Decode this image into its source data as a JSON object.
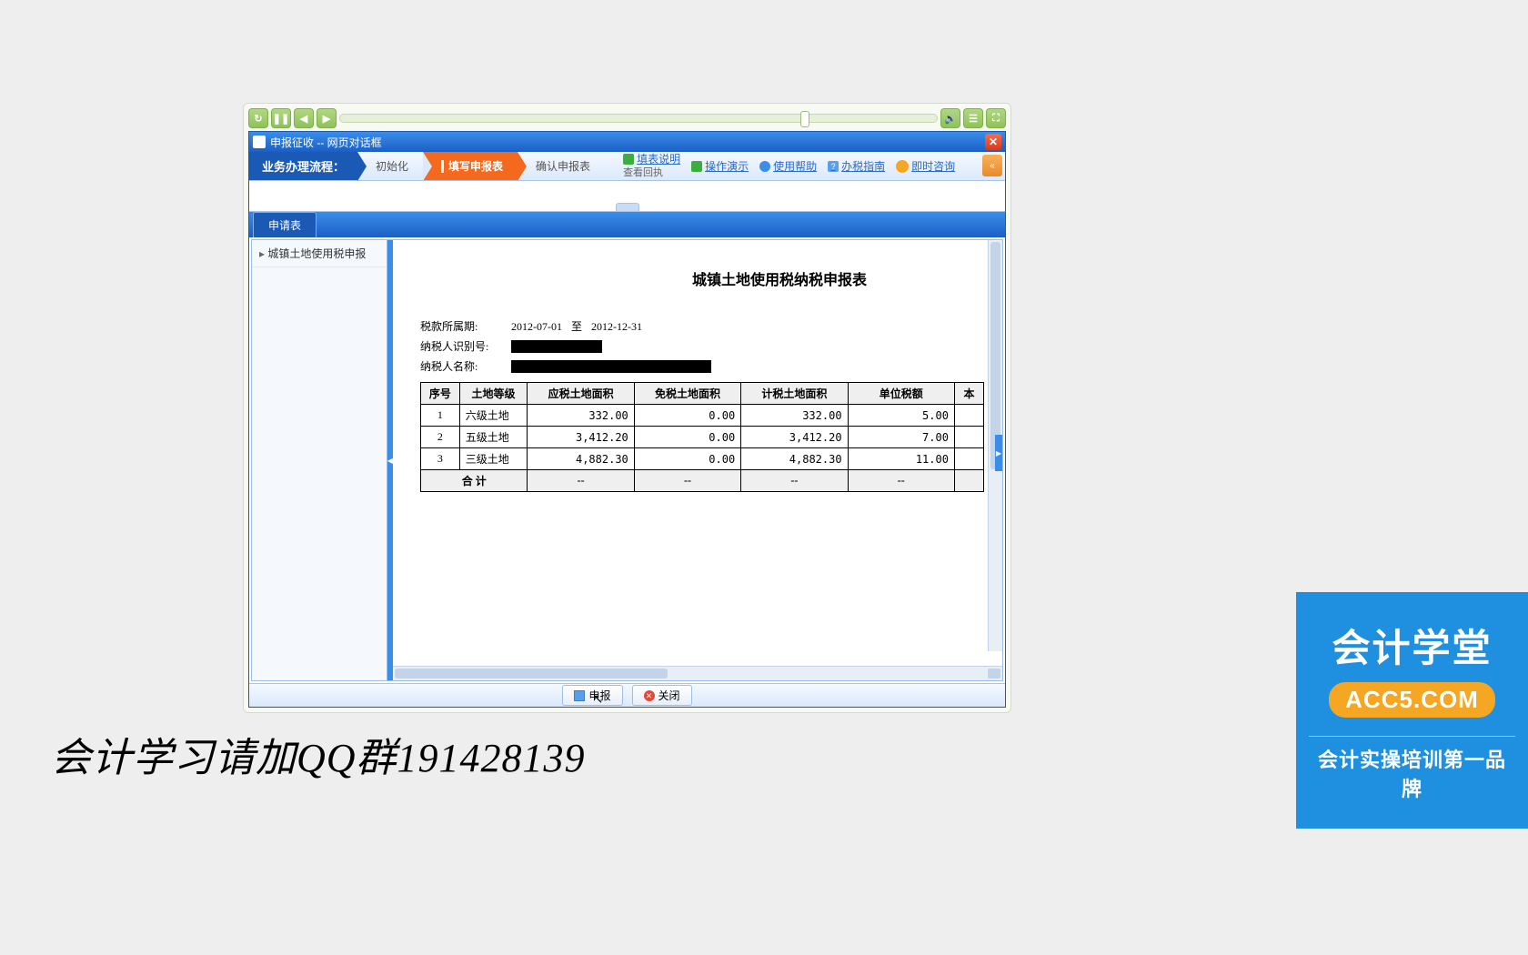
{
  "window": {
    "title": "申报征收  --  网页对话框"
  },
  "flow": {
    "label": "业务办理流程：",
    "steps": [
      "初始化",
      "填写申报表",
      "确认申报表"
    ],
    "active_index": 1,
    "sublink": "查看回执"
  },
  "toolbar_links": [
    "填表说明",
    "操作演示",
    "使用帮助",
    "办税指南",
    "即时咨询"
  ],
  "tab": "申请表",
  "sidebar": {
    "items": [
      "城镇土地使用税申报"
    ]
  },
  "report": {
    "title": "城镇土地使用税纳税申报表",
    "period_label": "税款所属期:",
    "period_from": "2012-07-01",
    "period_sep": "至",
    "period_to": "2012-12-31",
    "taxpayer_id_label": "纳税人识别号:",
    "taxpayer_name_label": "纳税人名称:",
    "columns": [
      "序号",
      "土地等级",
      "应税土地面积",
      "免税土地面积",
      "计税土地面积",
      "单位税额",
      "本"
    ],
    "rows": [
      {
        "no": "1",
        "grade": "六级土地",
        "taxable_area": "332.00",
        "exempt_area": "0.00",
        "calc_area": "332.00",
        "unit_tax": "5.00"
      },
      {
        "no": "2",
        "grade": "五级土地",
        "taxable_area": "3,412.20",
        "exempt_area": "0.00",
        "calc_area": "3,412.20",
        "unit_tax": "7.00"
      },
      {
        "no": "3",
        "grade": "三级土地",
        "taxable_area": "4,882.30",
        "exempt_area": "0.00",
        "calc_area": "4,882.30",
        "unit_tax": "11.00"
      }
    ],
    "total_label": "合  计",
    "dash": "--"
  },
  "footer": {
    "submit": "申报",
    "close": "关闭"
  },
  "overlay": "会计学习请加QQ群191428139",
  "ad": {
    "title": "会计学堂",
    "badge": "ACC5.COM",
    "sub": "会计实操培训第一品牌"
  }
}
